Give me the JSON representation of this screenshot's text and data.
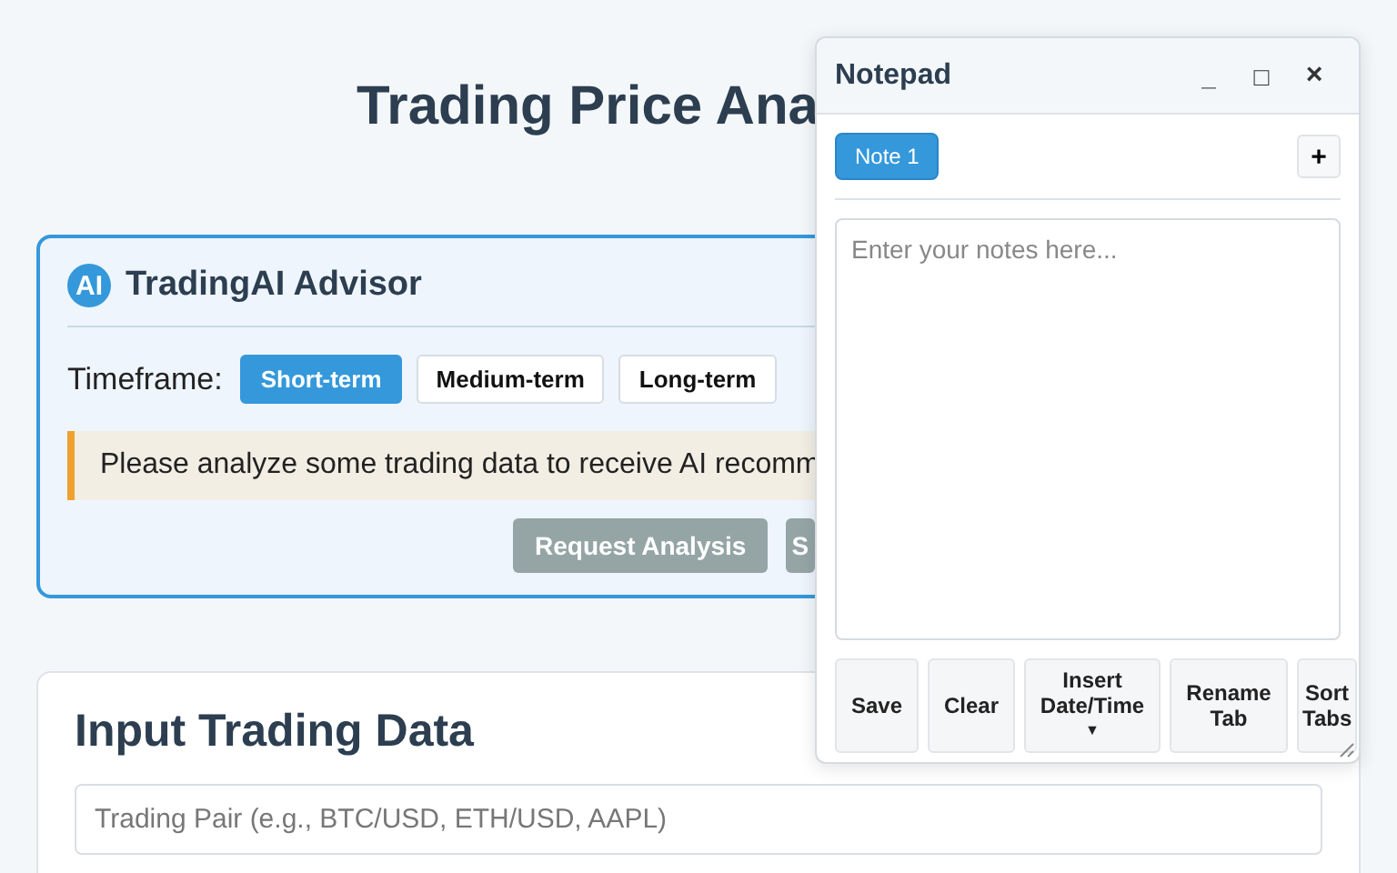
{
  "page_title": "Trading Price Ana",
  "advisor": {
    "logo": "AI",
    "title": "TradingAI Advisor",
    "timeframe_label": "Timeframe:",
    "timeframes": [
      {
        "label": "Short-term",
        "selected": true
      },
      {
        "label": "Medium-term",
        "selected": false
      },
      {
        "label": "Long-term",
        "selected": false
      }
    ],
    "message": "Please analyze some trading data to receive AI recomm",
    "actions": [
      {
        "label": "Request Analysis",
        "disabled": true
      },
      {
        "label": "S",
        "disabled": true
      }
    ]
  },
  "input_section": {
    "title": "Input Trading Data",
    "pair_field": {
      "placeholder": "Trading Pair (e.g., BTC/USD, ETH/USD, AAPL)"
    }
  },
  "notepad": {
    "title": "Notepad",
    "controls": [
      {
        "kind": "minimize",
        "label": "_"
      },
      {
        "kind": "maximize",
        "label": "□"
      },
      {
        "kind": "close",
        "label": "×"
      }
    ],
    "tabs": [
      {
        "label": "Note 1",
        "selected": true
      }
    ],
    "add_tab": "+",
    "editor": {
      "placeholder": "Enter your notes here..."
    },
    "buttons": [
      {
        "label": "Save"
      },
      {
        "label": "Clear"
      },
      {
        "label": "Insert Date/Time",
        "caret": "▼"
      },
      {
        "label": "Rename Tab"
      },
      {
        "label": "Sort Tabs"
      }
    ]
  }
}
